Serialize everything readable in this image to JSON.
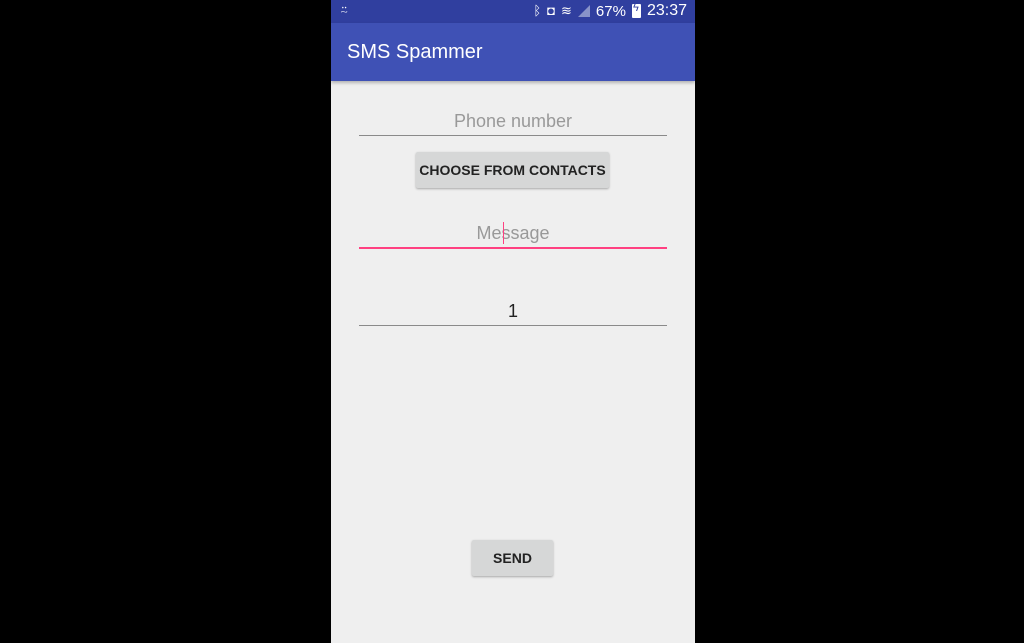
{
  "status_bar": {
    "notification_icon": "missed-call-icon",
    "icons": [
      "bluetooth-icon",
      "vibrate-icon",
      "wifi-icon",
      "signal-icon",
      "battery-charging-icon"
    ],
    "battery": "67%",
    "time": "23:37"
  },
  "app_bar": {
    "title": "SMS Spammer"
  },
  "form": {
    "phone_placeholder": "Phone number",
    "choose_contacts_label": "CHOOSE FROM CONTACTS",
    "message_placeholder": "Message",
    "count_value": "1",
    "send_label": "SEND"
  },
  "colors": {
    "status_bar": "#303f9f",
    "app_bar": "#3f51b5",
    "accent": "#ff4081",
    "background": "#efefef",
    "button": "#d6d7d7"
  }
}
